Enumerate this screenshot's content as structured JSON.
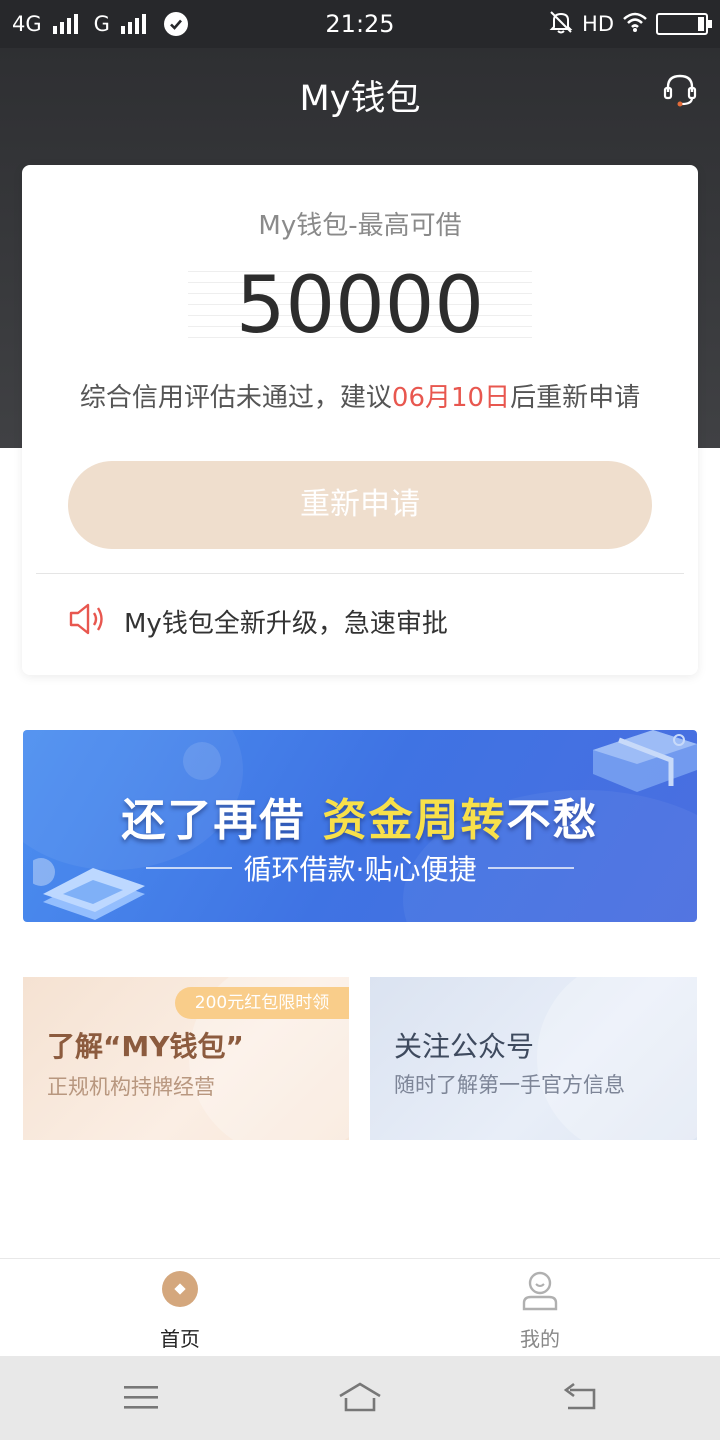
{
  "status_bar": {
    "network1": "4G",
    "network2": "G",
    "time": "21:25",
    "hd": "HD",
    "icons": [
      "signal-icon",
      "check-circle-icon",
      "mute-icon",
      "wifi-icon",
      "battery-icon"
    ]
  },
  "header": {
    "title": "My钱包",
    "service_icon": "headset-icon"
  },
  "credit_card": {
    "limit_label": "My钱包-最高可借",
    "amount": "50000",
    "notice_prefix": "综合信用评估未通过，建议",
    "notice_date": "06月10日",
    "notice_suffix": "后重新申请",
    "reapply_label": "重新申请",
    "upgrade_text": "My钱包全新升级，急速审批",
    "date_color": "#e8574f",
    "button_color": "#efdecd"
  },
  "banner": {
    "headline_white": "还了再借",
    "headline_yellow": "资金周转",
    "headline_white_2": "不愁",
    "subtitle": "循环借款·贴心便捷"
  },
  "cards": {
    "about": {
      "badge": "200元红包限时领",
      "title": "了解“MY钱包”",
      "subtitle": "正规机构持牌经营"
    },
    "follow": {
      "title": "关注公众号",
      "subtitle": "随时了解第一手官方信息"
    }
  },
  "tab_bar": {
    "home_label": "首页",
    "mine_label": "我的",
    "active_color": "#d4a77d"
  },
  "system_nav": {
    "icons": [
      "menu-icon",
      "home-icon",
      "back-icon"
    ]
  }
}
